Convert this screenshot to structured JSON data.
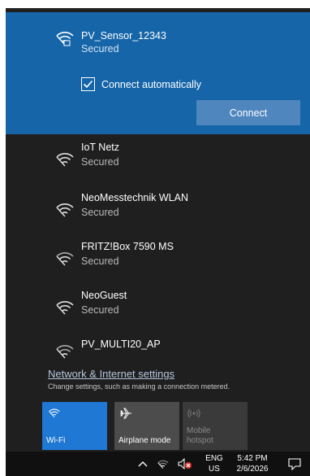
{
  "selected_network": {
    "name": "PV_Sensor_12343",
    "status": "Secured",
    "auto_connect_label": "Connect automatically",
    "auto_connect_checked": true,
    "connect_button": "Connect"
  },
  "networks": [
    {
      "name": "IoT Netz",
      "status": "Secured"
    },
    {
      "name": "NeoMesstechnik WLAN",
      "status": "Secured"
    },
    {
      "name": "FRITZ!Box 7590 MS",
      "status": "Secured"
    },
    {
      "name": "NeoGuest",
      "status": "Secured"
    },
    {
      "name": "PV_MULTI20_AP",
      "status": ""
    }
  ],
  "settings": {
    "link": "Network & Internet settings",
    "description": "Change settings, such as making a connection metered."
  },
  "quick_actions": [
    {
      "label": "Wi-Fi",
      "icon": "wifi-icon",
      "state": "on"
    },
    {
      "label": "Airplane mode",
      "icon": "airplane-icon",
      "state": "off"
    },
    {
      "label": "Mobile hotspot",
      "icon": "hotspot-icon",
      "state": "disabled"
    }
  ],
  "taskbar": {
    "language": "ENG",
    "region": "US",
    "time": "5:42 PM",
    "date": "2/6/2026"
  },
  "colors": {
    "flyout_bg": "#1f1f1f",
    "selected_bg": "#1565a8",
    "accent": "#1e78d4",
    "button_bg": "#4f86bd",
    "taskbar_bg": "#101010"
  }
}
